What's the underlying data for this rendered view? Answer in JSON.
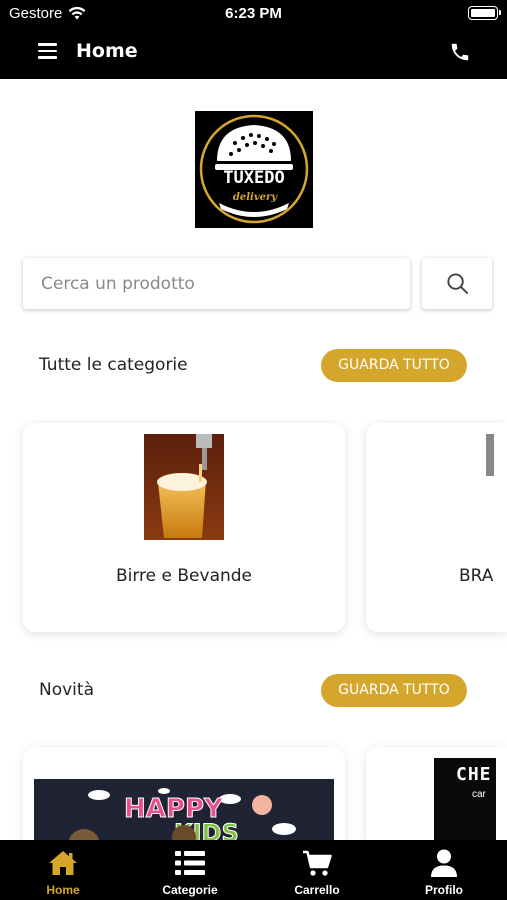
{
  "status_bar": {
    "carrier": "Gestore",
    "time": "6:23 PM"
  },
  "header": {
    "title": "Home"
  },
  "logo": {
    "brand_text": "TUXEDO",
    "tagline": "delivery",
    "accent_color": "#d4a72c"
  },
  "search": {
    "placeholder": "Cerca un prodotto"
  },
  "categories_section": {
    "title": "Tutte le categorie",
    "see_all_label": "GUARDA TUTTO",
    "items": [
      {
        "label": "Birre e Bevande"
      },
      {
        "label": "BRA"
      }
    ]
  },
  "news_section": {
    "title": "Novità",
    "see_all_label": "GUARDA TUTTO",
    "items": [
      {
        "image_text_1": "HAPPY",
        "image_text_2": "KIDS"
      },
      {
        "image_text": "CHE",
        "image_subtext": "car"
      }
    ]
  },
  "tab_bar": {
    "tabs": [
      {
        "label": "Home",
        "icon": "home-icon",
        "active": true
      },
      {
        "label": "Categorie",
        "icon": "list-icon",
        "active": false
      },
      {
        "label": "Carrello",
        "icon": "cart-icon",
        "active": false
      },
      {
        "label": "Profilo",
        "icon": "user-icon",
        "active": false
      }
    ]
  },
  "colors": {
    "accent": "#d4a72c",
    "bar_background": "#000000"
  }
}
